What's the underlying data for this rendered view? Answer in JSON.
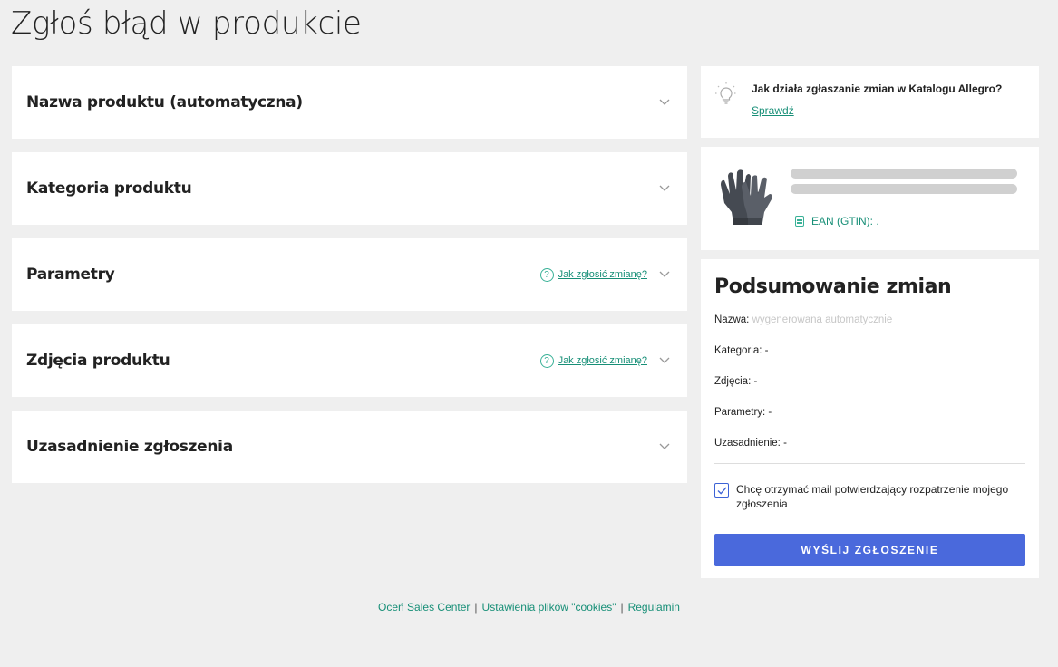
{
  "page_title": "Zgłoś błąd w produkcie",
  "sections": [
    {
      "title": "Nazwa produktu (automatyczna)",
      "help": ""
    },
    {
      "title": "Kategoria produktu",
      "help": ""
    },
    {
      "title": "Parametry",
      "help": "Jak zgłosić zmianę?"
    },
    {
      "title": "Zdjęcia produktu",
      "help": "Jak zgłosić zmianę?"
    },
    {
      "title": "Uzasadnienie zgłoszenia",
      "help": ""
    }
  ],
  "info": {
    "text": "Jak działa zgłaszanie zmian w Katalogu Allegro?",
    "link": "Sprawdź"
  },
  "product": {
    "ean_label": "EAN (GTIN): ."
  },
  "summary": {
    "title": "Podsumowanie zmian",
    "name_label": "Nazwa:",
    "name_value": "wygenerowana automatycznie",
    "category": "Kategoria: -",
    "photos": "Zdjęcia: -",
    "params": "Parametry: -",
    "justification": "Uzasadnienie: -",
    "consent": "Chcę otrzymać mail potwierdzający rozpatrzenie mojego zgłoszenia",
    "consent_checked": true,
    "submit": "WYŚLIJ ZGŁOSZENIE"
  },
  "footer": {
    "rate": "Oceń Sales Center",
    "cookies": "Ustawienia plików \"cookies\"",
    "terms": "Regulamin"
  },
  "colors": {
    "accent": "#178f77",
    "button": "#4a69dc"
  }
}
